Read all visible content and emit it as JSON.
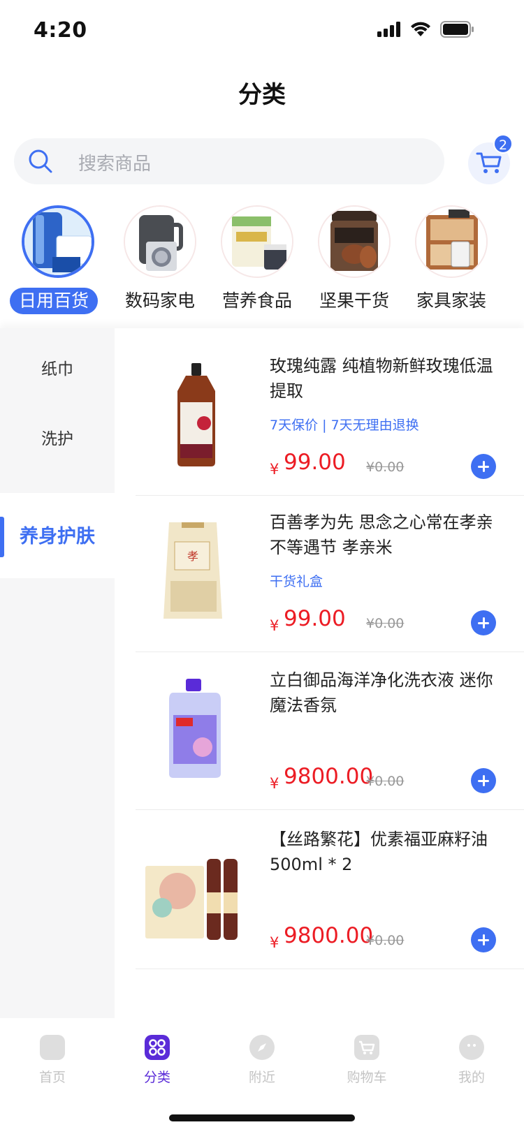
{
  "status_bar": {
    "time": "4:20"
  },
  "page_title": "分类",
  "search": {
    "placeholder": "搜索商品"
  },
  "cart": {
    "badge_count": "2"
  },
  "top_categories": [
    {
      "label": "日用百货",
      "active": true
    },
    {
      "label": "数码家电",
      "active": false
    },
    {
      "label": "营养食品",
      "active": false
    },
    {
      "label": "坚果干货",
      "active": false
    },
    {
      "label": "家具家装",
      "active": false
    }
  ],
  "side_menu": [
    {
      "label": "纸巾",
      "active": false
    },
    {
      "label": "洗护",
      "active": false
    },
    {
      "label": "养身护肤",
      "active": true
    }
  ],
  "products": [
    {
      "title": "玫瑰纯露  纯植物新鲜玫瑰低温提取",
      "tag": "7天保价 | 7天无理由退换",
      "currency": "¥",
      "price": "99.00",
      "old_price": "¥0.00"
    },
    {
      "title": "百善孝为先   思念之心常在孝亲不等遇节 孝亲米",
      "tag": "干货礼盒",
      "currency": "¥",
      "price": "99.00",
      "old_price": "¥0.00"
    },
    {
      "title": "立白御品海洋净化洗衣液  迷你魔法香氛",
      "tag": "",
      "currency": "¥",
      "price": "9800.00",
      "old_price": "¥0.00"
    },
    {
      "title": "【丝路繁花】优素福亚麻籽油 500ml * 2",
      "tag": "",
      "currency": "¥",
      "price": "9800.00",
      "old_price": "¥0.00"
    }
  ],
  "tab_bar": [
    {
      "label": "首页",
      "icon": "home-icon",
      "active": false
    },
    {
      "label": "分类",
      "icon": "category-icon",
      "active": true
    },
    {
      "label": "附近",
      "icon": "compass-icon",
      "active": false
    },
    {
      "label": "购物车",
      "icon": "cart-icon",
      "active": false
    },
    {
      "label": "我的",
      "icon": "profile-icon",
      "active": false
    }
  ],
  "colors": {
    "accent": "#3e6ff2",
    "price": "#ec1c24",
    "tab_active": "#5a2bd8"
  }
}
